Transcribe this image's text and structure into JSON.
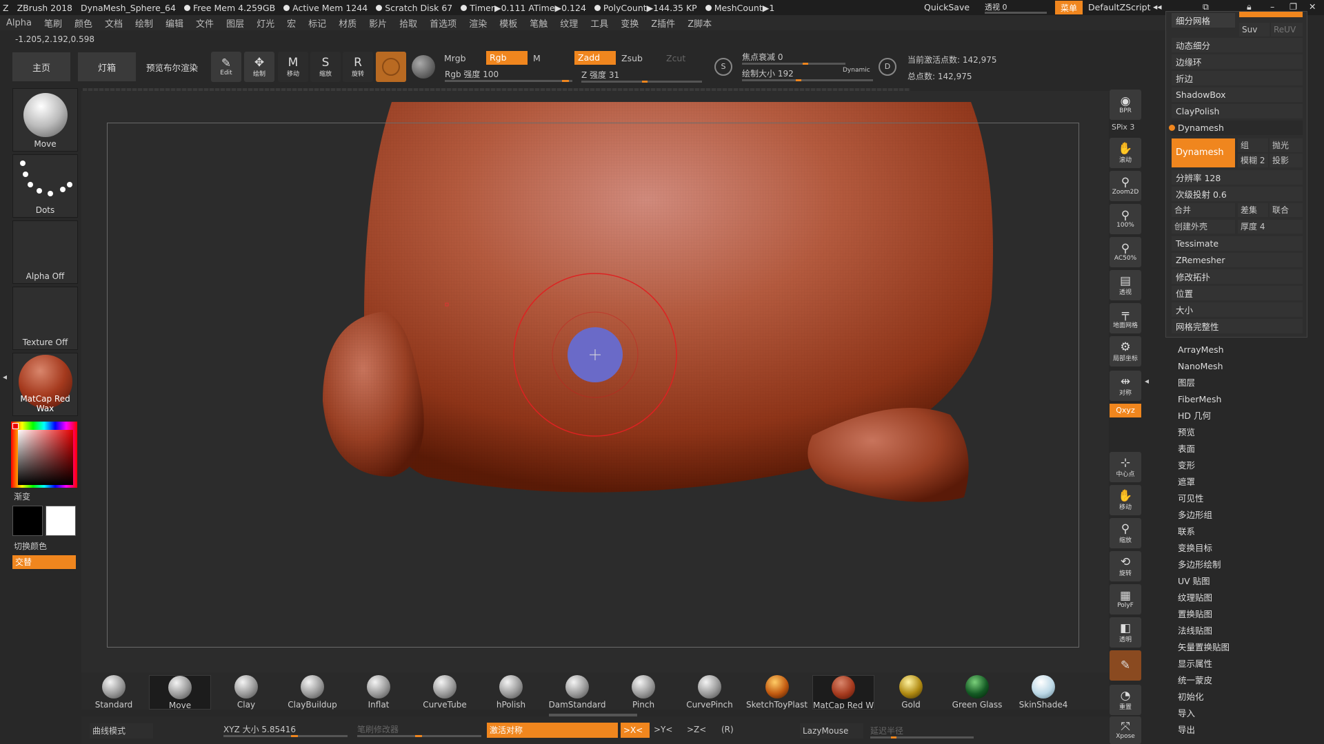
{
  "titlebar": {
    "app": "ZBrush 2018",
    "doc": "DynaMesh_Sphere_64",
    "free_mem": "Free Mem 4.259GB",
    "active_mem": "Active Mem 1244",
    "scratch": "Scratch Disk 67",
    "timer": "Timer▶0.111 ATime▶0.124",
    "polycount": "PolyCount▶144.35 KP",
    "meshcount": "MeshCount▶1",
    "quicksave": "QuickSave",
    "opacity_label": "透视 0",
    "menu_btn": "菜单",
    "script": "DefaultZScript"
  },
  "menubar": [
    "Alpha",
    "笔刷",
    "颜色",
    "文档",
    "绘制",
    "编辑",
    "文件",
    "图层",
    "灯光",
    "宏",
    "标记",
    "材质",
    "影片",
    "拾取",
    "首选项",
    "渲染",
    "模板",
    "笔触",
    "纹理",
    "工具",
    "变换",
    "Z插件",
    "Z脚本"
  ],
  "coords": "-1.205,2.192,0.598",
  "toolbar": {
    "home": "主页",
    "lightbox": "灯箱",
    "bpr": "预览布尔渲染",
    "edit": "Edit",
    "draw": "绘制",
    "move": "移动",
    "scale": "缩放",
    "rotate": "旋转",
    "mrgb": "Mrgb",
    "rgb": "Rgb",
    "m": "M",
    "zadd": "Zadd",
    "zsub": "Zsub",
    "zcut": "Zcut",
    "rgb_intensity": "Rgb 强度 100",
    "z_intensity": "Z 强度 31",
    "focal_shift": "焦点衰减 0",
    "draw_size": "绘制大小 192",
    "dynamic": "Dynamic",
    "active_points": "当前激活点数: 142,975",
    "total_points": "总点数: 142,975"
  },
  "left": {
    "brush": "Move",
    "stroke": "Dots",
    "alpha": "Alpha Off",
    "texture": "Texture Off",
    "material": "MatCap Red Wax",
    "gradient": "渐变",
    "switch_color": "切换颜色",
    "alternate": "交替"
  },
  "right_tools": [
    "BPR",
    "SPix 3",
    "滚动",
    "Zoom2D",
    "100%",
    "AC50%",
    "透视",
    "地面网格",
    "局部坐标",
    "对称",
    "Qxyz",
    "中心点",
    "移动",
    "缩放",
    "旋转",
    "PolyF",
    "透明",
    "重置",
    "Xpose"
  ],
  "panel": {
    "items": [
      "细分网格",
      "动态细分",
      "边缘环",
      "折边",
      "ShadowBox",
      "ClayPolish",
      "Dynamesh"
    ],
    "suv": "Suv",
    "reuv": "ReUV",
    "dynamesh_btn": "Dynamesh",
    "group": "组",
    "polish": "抛光",
    "blur": "模糊 2",
    "project": "投影",
    "resolution": "分辨率 128",
    "subproject": "次级投射 0.6",
    "add": "合并",
    "sub": "差集",
    "and": "联合",
    "create_shell": "创建外壳",
    "thickness": "厚度 4",
    "items2": [
      "Tessimate",
      "ZRemesher",
      "修改拓扑",
      "位置",
      "大小",
      "网格完整性"
    ]
  },
  "submenu": [
    "ArrayMesh",
    "NanoMesh",
    "图层",
    "FiberMesh",
    "HD 几何",
    "预览",
    "表面",
    "变形",
    "遮罩",
    "可见性",
    "多边形组",
    "联系",
    "变换目标",
    "多边形绘制",
    "UV 贴图",
    "纹理贴图",
    "置换贴图",
    "法线贴图",
    "矢量置换贴图",
    "显示属性",
    "统一蒙皮",
    "初始化",
    "导入",
    "导出"
  ],
  "brushes": [
    "Standard",
    "Move",
    "Clay",
    "ClayBuildup",
    "Inflat",
    "CurveTube",
    "hPolish",
    "DamStandard",
    "Pinch",
    "CurvePinch",
    "SketchToyPlastic",
    "MatCap Red Wax",
    "Gold",
    "Green Glass",
    "SkinShade4"
  ],
  "bottom": {
    "curve_mode": "曲线模式",
    "xyz_size": "XYZ 大小 5.85416",
    "brush_modifier": "笔刷修改器",
    "activate_sym": "激活对称",
    "x": ">X<",
    "y": ">Y<",
    "z": ">Z<",
    "r": "(R)",
    "lazymouse": "LazyMouse",
    "lazy_radius": "延迟半径"
  }
}
